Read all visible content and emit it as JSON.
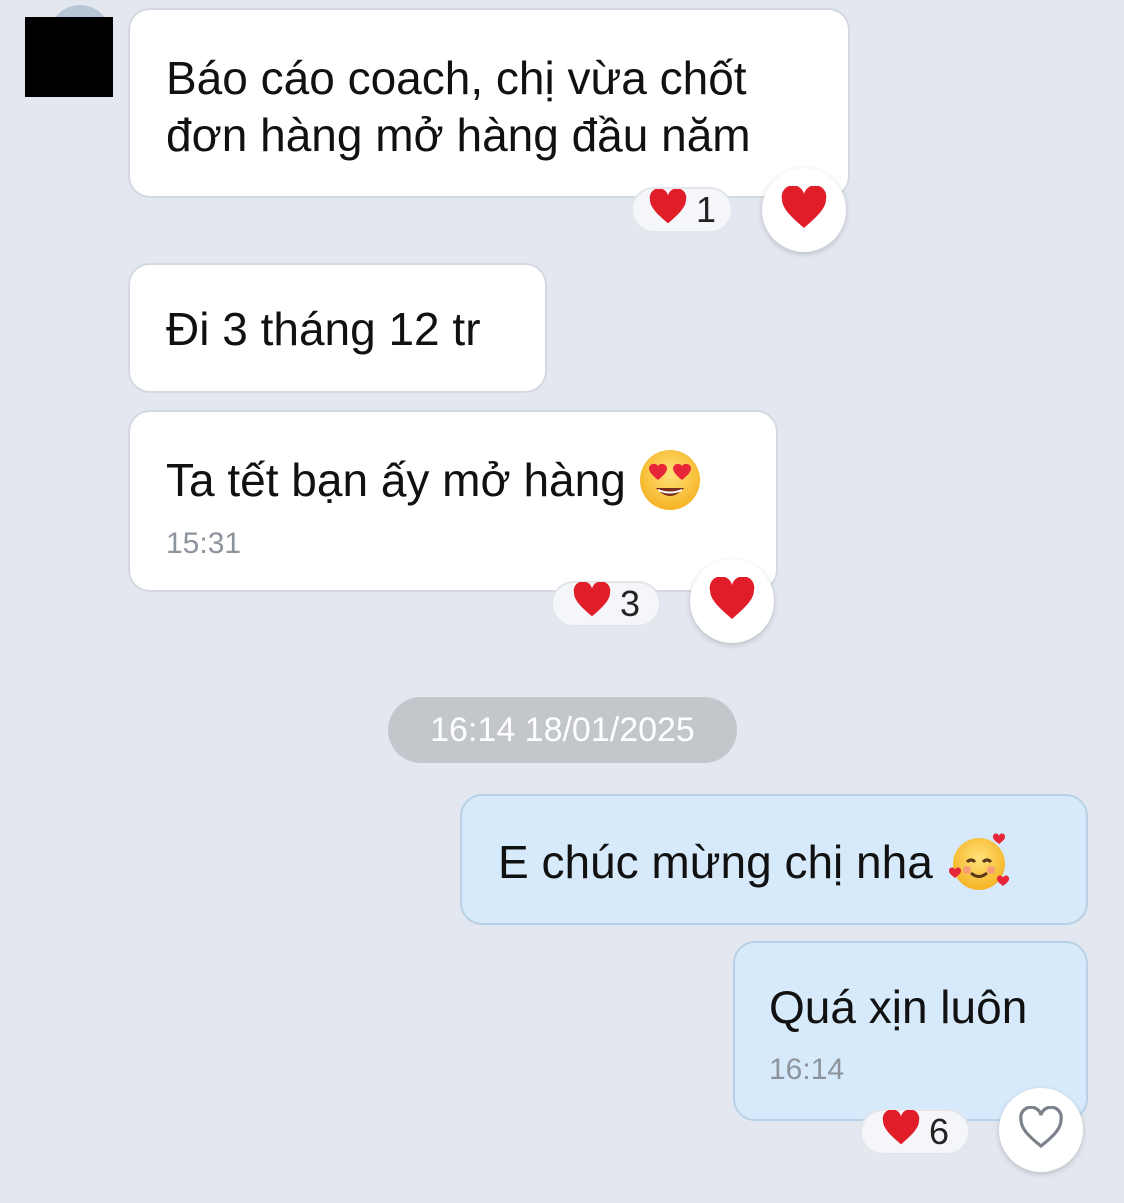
{
  "messages": [
    {
      "text_line1": "Báo cáo coach, chị vừa chốt",
      "text_line2": "đơn hàng mở hàng đầu năm",
      "reaction_count": "1"
    },
    {
      "text": "Đi 3 tháng 12 tr"
    },
    {
      "text": "Ta tết bạn ấy mở hàng",
      "emoji": "heart-eyes",
      "time": "15:31",
      "reaction_count": "3"
    },
    {
      "date_separator": "16:14 18/01/2025"
    },
    {
      "text": "E chúc mừng chị nha",
      "emoji": "smiling-face-with-hearts"
    },
    {
      "text": "Quá xịn luôn",
      "time": "16:14",
      "reaction_count": "6"
    }
  ],
  "icons": {
    "reaction": "heart-icon",
    "reaction_outline": "heart-outline-icon"
  },
  "colors": {
    "background": "#e3e7ef",
    "incoming_bubble": "#ffffff",
    "outgoing_bubble": "#d6eafb",
    "heart": "#e11d2a"
  }
}
